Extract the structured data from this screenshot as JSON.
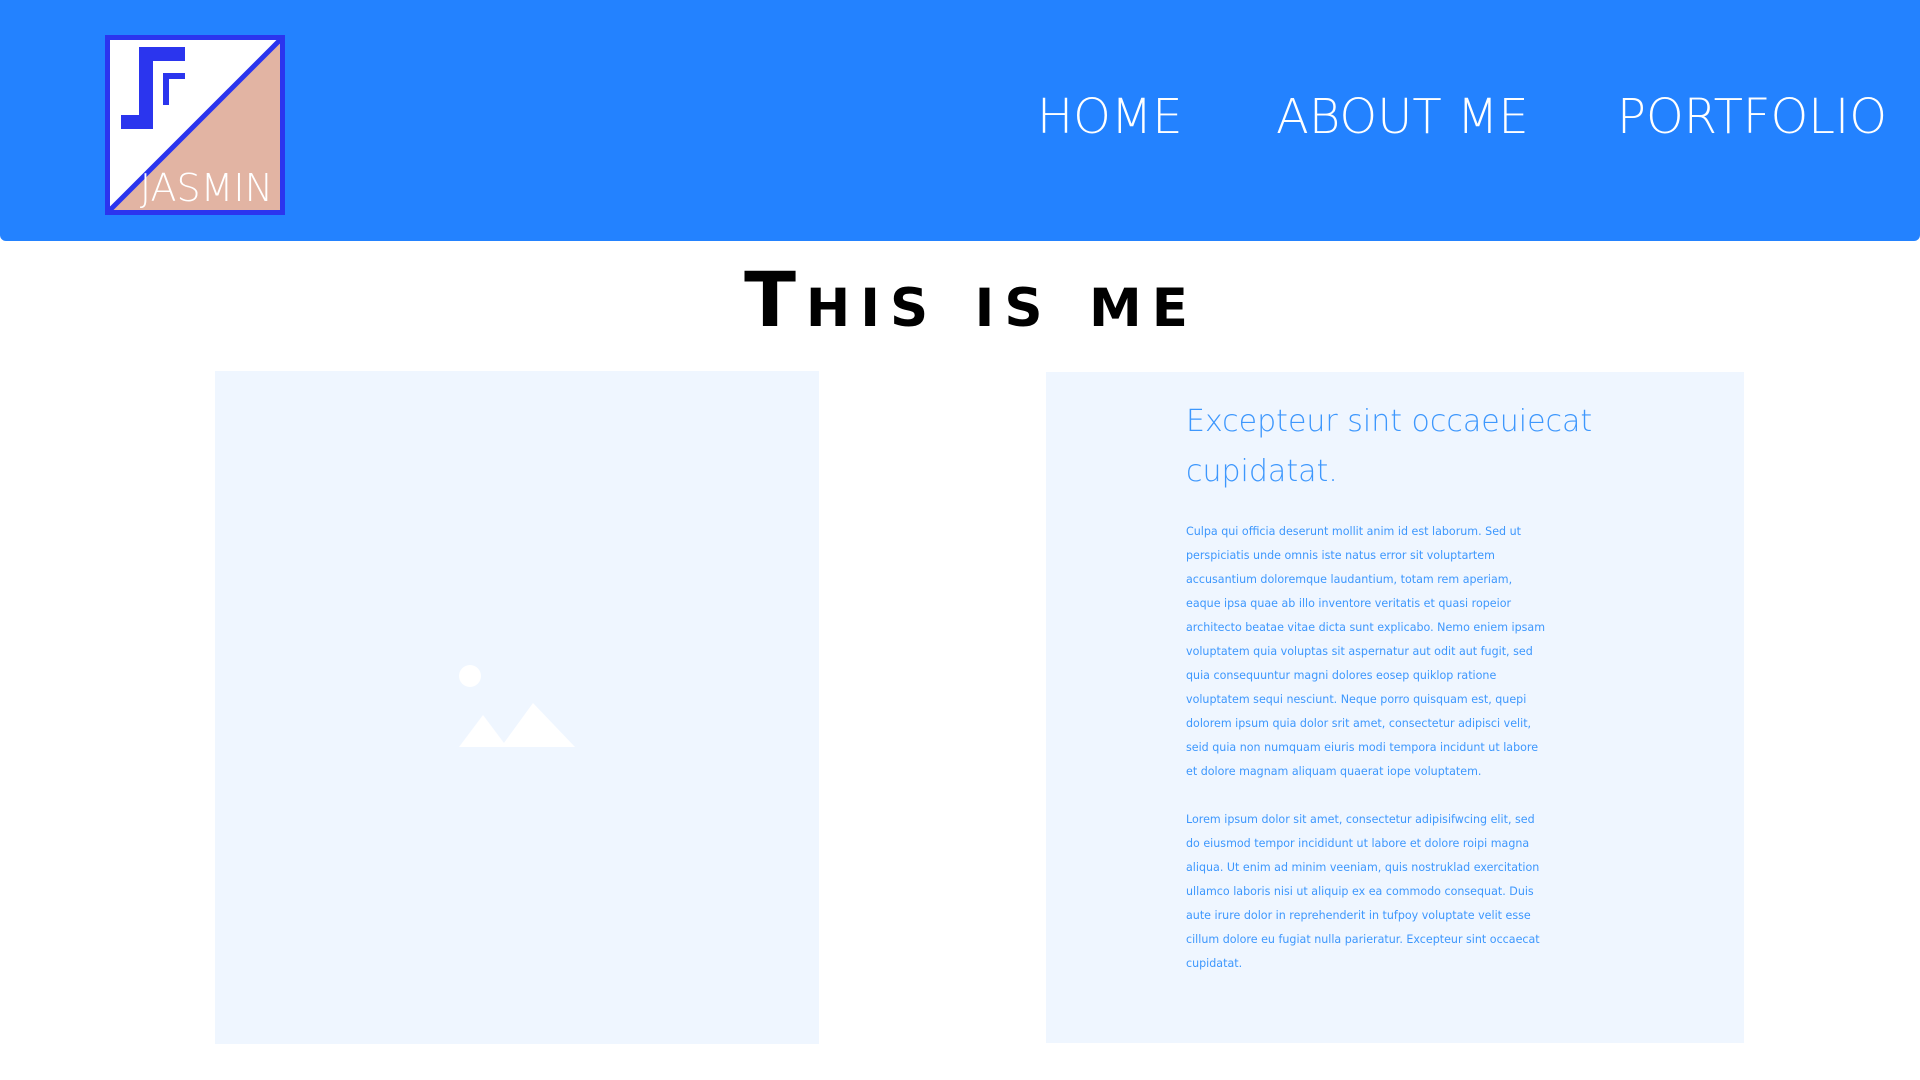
{
  "header": {
    "logo_text": "JASMIN",
    "colors": {
      "bar": "#2382ff",
      "logo_blue": "#2b35ee",
      "logo_peach": "#e2b4a3"
    }
  },
  "nav": {
    "items": [
      {
        "label": "HOME"
      },
      {
        "label": "ABOUT ME"
      },
      {
        "label": "PORTFOLIO"
      }
    ]
  },
  "main": {
    "title": "This is me",
    "image_icon": "image-placeholder-icon",
    "card": {
      "heading": "Excepteur sint occaeuiecat cupidatat.",
      "paragraphs": [
        "Culpa qui officia deserunt mollit anim id est laborum. Sed ut perspiciatis unde omnis iste natus error sit voluptartem accusantium doloremque laudantium, totam rem aperiam, eaque ipsa quae ab illo inventore veritatis et quasi ropeior architecto beatae vitae dicta sunt explicabo. Nemo eniem ipsam voluptatem quia voluptas sit aspernatur aut odit aut fugit, sed quia consequuntur magni dolores eosep quiklop ratione voluptatem sequi nesciunt. Neque porro quisquam est, quepi dolorem ipsum quia dolor srit amet, consectetur adipisci velit, seid quia non numquam eiuris modi tempora incidunt ut labore et dolore magnam aliquam quaerat iope voluptatem.",
        "Lorem ipsum dolor sit amet, consectetur adipisifwcing elit, sed do eiusmod tempor incididunt ut labore et dolore roipi magna aliqua. Ut enim ad minim veeniam, quis nostruklad exercitation ullamco laboris nisi ut aliquip ex ea commodo consequat. Duis aute irure dolor in reprehenderit in tufpoy voluptate velit esse cillum dolore eu fugiat nulla parieratur. Excepteur sint occaecat cupidatat."
      ]
    },
    "colors": {
      "panel_bg": "#eff6ff",
      "body_text": "#3d97fd"
    }
  }
}
